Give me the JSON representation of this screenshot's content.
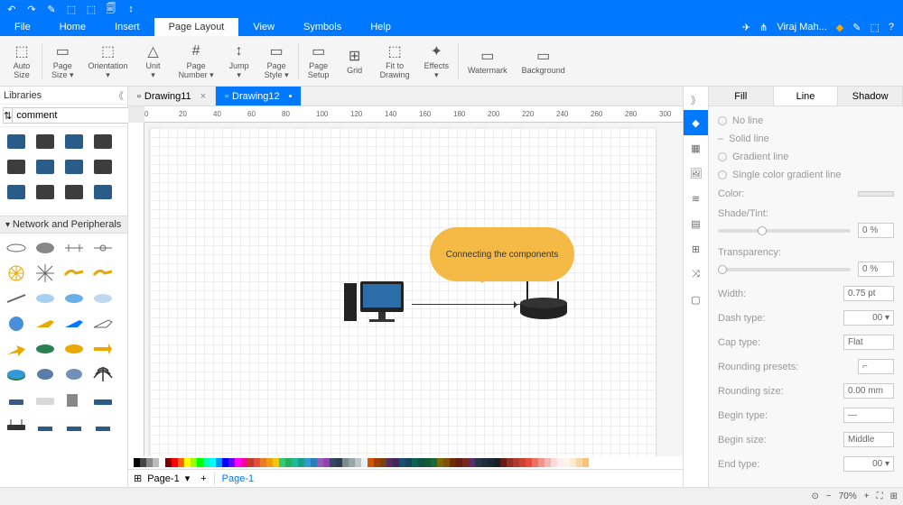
{
  "topbar": {
    "icons": [
      "↶",
      "↷",
      "✎",
      "⬚",
      "⬚",
      "🗐",
      "↕"
    ]
  },
  "menubar": {
    "items": [
      "File",
      "Home",
      "Insert",
      "Page Layout",
      "View",
      "Symbols",
      "Help"
    ],
    "active": 3,
    "user": "Viraj Mah...",
    "right_icons": [
      "◈",
      "✎",
      "⬚",
      "?"
    ]
  },
  "ribbon": [
    {
      "icon": "⬚",
      "label": "Auto\nSize"
    },
    {
      "icon": "▭",
      "label": "Page\nSize ▾"
    },
    {
      "icon": "⬚",
      "label": "Orientation\n▾"
    },
    {
      "icon": "△",
      "label": "Unit\n▾"
    },
    {
      "icon": "#",
      "label": "Page\nNumber ▾"
    },
    {
      "icon": "↕",
      "label": "Jump\n▾"
    },
    {
      "icon": "▭",
      "label": "Page\nStyle ▾"
    },
    {
      "icon": "▭",
      "label": "Page\nSetup"
    },
    {
      "icon": "⊞",
      "label": "Grid"
    },
    {
      "icon": "⬚",
      "label": "Fit to\nDrawing"
    },
    {
      "icon": "✦",
      "label": "Effects\n▾"
    },
    {
      "icon": "▭",
      "label": "Watermark"
    },
    {
      "icon": "▭",
      "label": "Background"
    }
  ],
  "libraries": {
    "title": "Libraries",
    "search": {
      "placeholder": "",
      "value": "comment"
    },
    "section": "Network and Peripherals"
  },
  "tabs": [
    {
      "label": "Drawing11",
      "active": false,
      "dirty": false
    },
    {
      "label": "Drawing12",
      "active": true,
      "dirty": true
    }
  ],
  "ruler_marks": [
    "0",
    "20",
    "40",
    "60",
    "80",
    "100",
    "120",
    "140",
    "160",
    "180",
    "200",
    "220",
    "240",
    "260",
    "280",
    "300"
  ],
  "canvas": {
    "callout_text": "Connecting the components"
  },
  "rightpanel": {
    "tabs": [
      "Fill",
      "Line",
      "Shadow"
    ],
    "active": 1,
    "line_types": [
      "No line",
      "Solid line",
      "Gradient line",
      "Single color gradient line"
    ],
    "color_label": "Color:",
    "shade_label": "Shade/Tint:",
    "shade_value": "0 %",
    "transparency_label": "Transparency:",
    "transparency_value": "0 %",
    "width_label": "Width:",
    "width_value": "0.75 pt",
    "dash_label": "Dash type:",
    "dash_value": "00 ▾",
    "cap_label": "Cap type:",
    "cap_value": "Flat",
    "rounding_presets_label": "Rounding presets:",
    "rounding_size_label": "Rounding size:",
    "rounding_size_value": "0.00 mm",
    "begin_type_label": "Begin type:",
    "begin_size_label": "Begin size:",
    "begin_size_value": "Middle",
    "end_type_label": "End type:",
    "end_type_value": "00 ▾"
  },
  "pagefooter": {
    "page": "Page-1",
    "page2": "Page-1"
  },
  "statusbar": {
    "zoom": "70%"
  },
  "colors": [
    "#000",
    "#444",
    "#888",
    "#bbb",
    "#fff",
    "#800000",
    "#f00",
    "#f60",
    "#ff0",
    "#9f0",
    "#0f0",
    "#0fa",
    "#0ff",
    "#09f",
    "#00f",
    "#60f",
    "#f0f",
    "#f09",
    "#c0392b",
    "#e74c3c",
    "#e67e22",
    "#f39c12",
    "#f1c40f",
    "#2ecc71",
    "#27ae60",
    "#1abc9c",
    "#16a085",
    "#3498db",
    "#2980b9",
    "#9b59b6",
    "#8e44ad",
    "#34495e",
    "#2c3e50",
    "#7f8c8d",
    "#95a5a6",
    "#bdc3c7",
    "#ecf0f1",
    "#d35400",
    "#a04000",
    "#784212",
    "#512e5f",
    "#4a235a",
    "#1b4f72",
    "#154360",
    "#0e6251",
    "#0b5345",
    "#145a32",
    "#186a3b",
    "#7d6608",
    "#7e5109",
    "#6e2c00",
    "#641e16",
    "#78281f",
    "#5b2c6f",
    "#283747",
    "#212f3c",
    "#1c2833",
    "#17202a",
    "#641e16",
    "#943126",
    "#b03a2e",
    "#cb4335",
    "#e74c3c",
    "#ec7063",
    "#f1948a",
    "#f5b7b1",
    "#fadbd8",
    "#fdedec",
    "#fef5e7",
    "#fdebd0",
    "#fad7a0",
    "#f8c471"
  ]
}
